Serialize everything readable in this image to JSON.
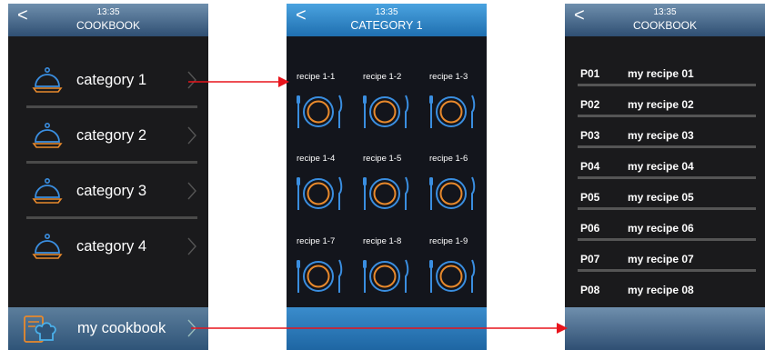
{
  "screens": [
    {
      "time": "13:35",
      "title": "COOKBOOK",
      "categories": [
        {
          "label": "category 1"
        },
        {
          "label": "category 2"
        },
        {
          "label": "category 3"
        },
        {
          "label": "category 4"
        }
      ],
      "my_cookbook_label": "my cookbook"
    },
    {
      "time": "13:35",
      "title": "CATEGORY 1",
      "recipes": [
        "recipe 1-1",
        "recipe 1-2",
        "recipe 1-3",
        "recipe 1-4",
        "recipe 1-5",
        "recipe 1-6",
        "recipe 1-7",
        "recipe 1-8",
        "recipe 1-9"
      ]
    },
    {
      "time": "13:35",
      "title": "COOKBOOK",
      "items": [
        {
          "code": "P01",
          "name": "my recipe 01"
        },
        {
          "code": "P02",
          "name": "my recipe 02"
        },
        {
          "code": "P03",
          "name": "my recipe 03"
        },
        {
          "code": "P04",
          "name": "my recipe 04"
        },
        {
          "code": "P05",
          "name": "my recipe 05"
        },
        {
          "code": "P06",
          "name": "my recipe 06"
        },
        {
          "code": "P07",
          "name": "my recipe 07"
        },
        {
          "code": "P08",
          "name": "my recipe 08"
        }
      ]
    }
  ],
  "icons": {
    "back": "back-chevron-icon",
    "category": "cloche-dome-icon",
    "chevron": "chevron-right-icon",
    "recipe": "plate-fork-knife-icon",
    "my_cookbook": "chef-book-icon"
  },
  "colors": {
    "accent_orange": "#e8892c",
    "accent_blue": "#3a8ee0",
    "arrow_red": "#e8141c",
    "screen_bg": "#1a1a1c"
  }
}
